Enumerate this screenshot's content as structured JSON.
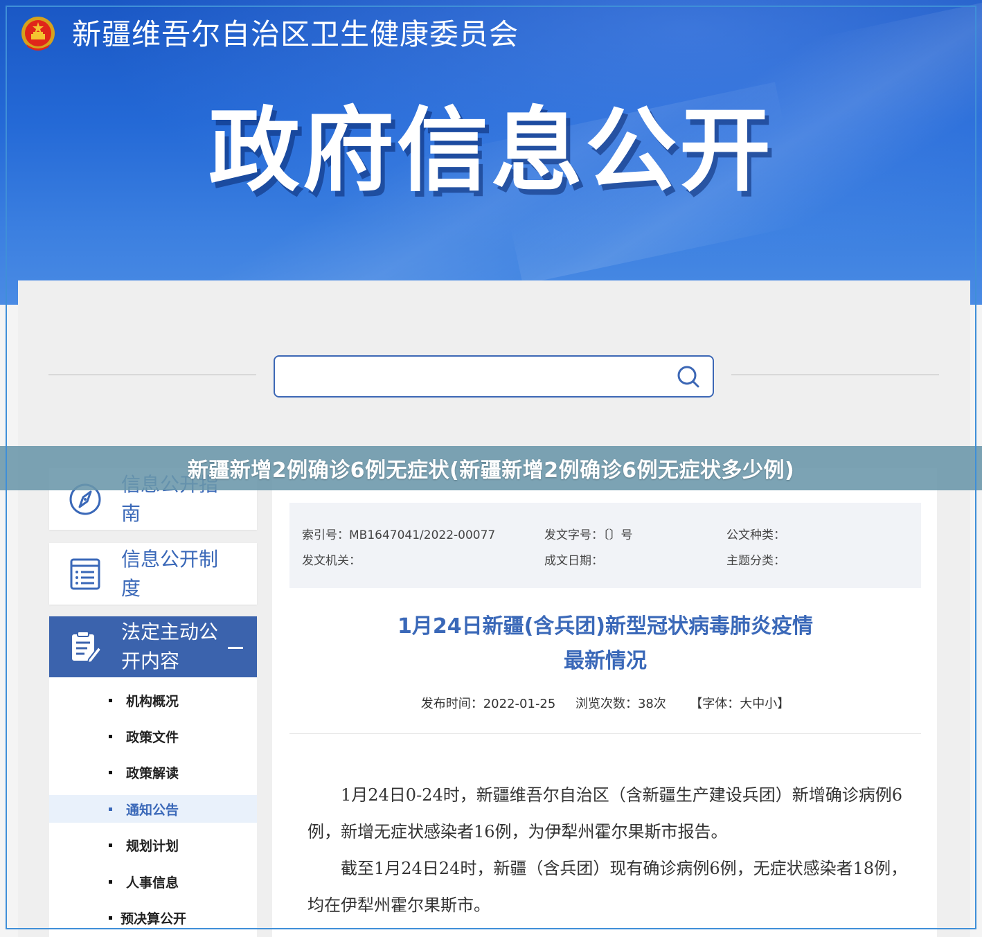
{
  "header": {
    "site_title": "新疆维吾尔自治区卫生健康委员会",
    "hero_title": "政府信息公开"
  },
  "search": {
    "placeholder": ""
  },
  "overlay_title": "新疆新增2例确诊6例无症状(新疆新增2例确诊6例无症状多少例)",
  "nav": {
    "cards": [
      {
        "label": "信息公开指南",
        "icon": "compass-icon"
      },
      {
        "label": "信息公开制度",
        "icon": "list-document-icon"
      },
      {
        "label": "法定主动公开内容",
        "icon": "edit-document-icon",
        "active": true
      }
    ],
    "subitems": [
      {
        "label": "机构概况"
      },
      {
        "label": "政策文件"
      },
      {
        "label": "政策解读"
      },
      {
        "label": "通知公告",
        "current": true
      },
      {
        "label": "规划计划"
      },
      {
        "label": "人事信息"
      },
      {
        "label": "预决算公开"
      }
    ]
  },
  "meta": {
    "index_no": "索引号：MB1647041/2022-00077",
    "doc_no": "发文字号：〔〕号",
    "doc_type": "公文种类：",
    "issuer": "发文机关：",
    "date_written": "成文日期：",
    "topic": "主题分类："
  },
  "article": {
    "title_line1": "1月24日新疆(含兵团)新型冠状病毒肺炎疫情",
    "title_line2": "最新情况",
    "publish_time": "发布时间：2022-01-25",
    "views": "浏览次数：38次",
    "font_label": "【字体：",
    "font_large": "大",
    "font_medium": "中",
    "font_small": "小",
    "font_end": "】",
    "paragraphs": [
      "1月24日0-24时，新疆维吾尔自治区（含新疆生产建设兵团）新增确诊病例6例，新增无症状感染者16例，为伊犁州霍尔果斯市报告。",
      "截至1月24日24时，新疆（含兵团）现有确诊病例6例，无症状感染者18例，均在伊犁州霍尔果斯市。"
    ]
  },
  "colors": {
    "brand_blue": "#3a68b8",
    "banner_blue": "#2469d6",
    "active_nav": "#3b63ad"
  }
}
